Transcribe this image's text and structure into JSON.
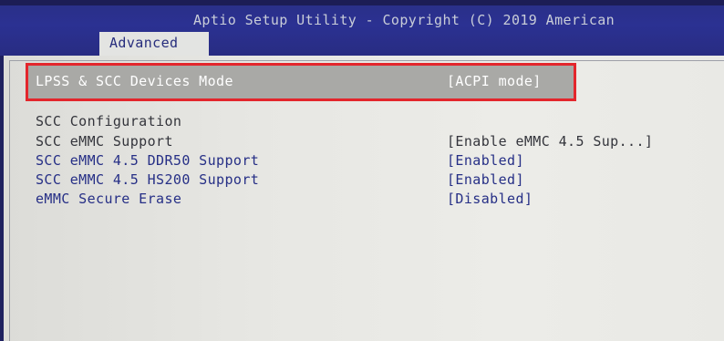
{
  "window": {
    "title": "Aptio Setup Utility - Copyright (C) 2019 American",
    "active_tab": "Advanced"
  },
  "colors": {
    "header_blue": "#2b3192",
    "panel_gray": "#e7e7e3",
    "highlight_gray": "#a9a9a6",
    "selection_red": "#e3262c",
    "text_blue": "#262f86",
    "text_dark": "#34353c"
  },
  "settings": {
    "selected": {
      "label": "LPSS & SCC Devices Mode",
      "value": "[ACPI mode]"
    },
    "section_header": "SCC Configuration",
    "items": [
      {
        "label": "SCC eMMC Support",
        "value": "[Enable eMMC 4.5 Sup...]"
      },
      {
        "label": "SCC eMMC 4.5 DDR50 Support",
        "value": "[Enabled]"
      },
      {
        "label": "SCC eMMC 4.5 HS200 Support",
        "value": "[Enabled]"
      },
      {
        "label": "eMMC Secure Erase",
        "value": "[Disabled]"
      }
    ]
  }
}
